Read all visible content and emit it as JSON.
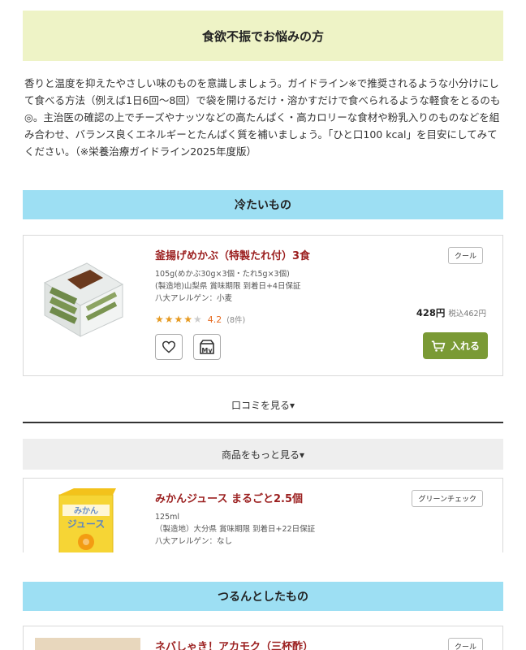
{
  "banner": {
    "title": "食欲不振でお悩みの方"
  },
  "intro": {
    "text": "香りと温度を抑えたやさしい味のものを意識しましょう。ガイドライン※で推奨されるような小分けにして食べる方法（例えば1日6回〜8回）で袋を開けるだけ・溶かすだけで食べられるような軽食をとるのも◎。主治医の確認の上でチーズやナッツなどの高たんぱく・高カロリーな食材や粉乳入りのものなどを組み合わせ、バランス良くエネルギーとたんぱく質を補いましょう。「ひと口100 kcal」を目安にしてみてください。（※栄養治療ガイドライン2025年度版）"
  },
  "sections": [
    {
      "title": "冷たいもの"
    },
    {
      "title": "つるんとしたもの"
    }
  ],
  "products": [
    {
      "name": "釜揚げめかぶ（特製たれ付）3食",
      "badge": "クール",
      "meta1": "105g(めかぶ30g×3個・たれ5g×3個)",
      "meta2": "(製造地)山梨県 賞味期限 到着日+4日保証",
      "meta3": "八大アレルゲン：小麦",
      "stars_filled": "★★★★",
      "stars_empty": "★",
      "rating": "4.2",
      "rating_count": "(8件)",
      "price": "428円",
      "price_tax": "税込462円",
      "cart_label": "入れる",
      "my_label": "My"
    },
    {
      "name": "みかんジュース まるごと2.5個",
      "badge": "グリーンチェック",
      "meta1": "125ml",
      "meta2": "（製造地）大分県 賞味期限 到着日+22日保証",
      "meta3": "八大アレルゲン：なし"
    },
    {
      "name": "ネバしゃき！アカモク（三杯酢）",
      "badge": "クール"
    }
  ],
  "links": {
    "reviews": "口コミを見る▾",
    "more": "商品をもっと見る▾"
  },
  "colors": {
    "banner_bg": "#eef3c6",
    "section_bg": "#9ddff3",
    "product_name": "#9b1f1f",
    "cart_button": "#7a9a35",
    "star": "#e69a21"
  },
  "icons": [
    "heart-icon",
    "my-list-icon",
    "cart-icon"
  ]
}
